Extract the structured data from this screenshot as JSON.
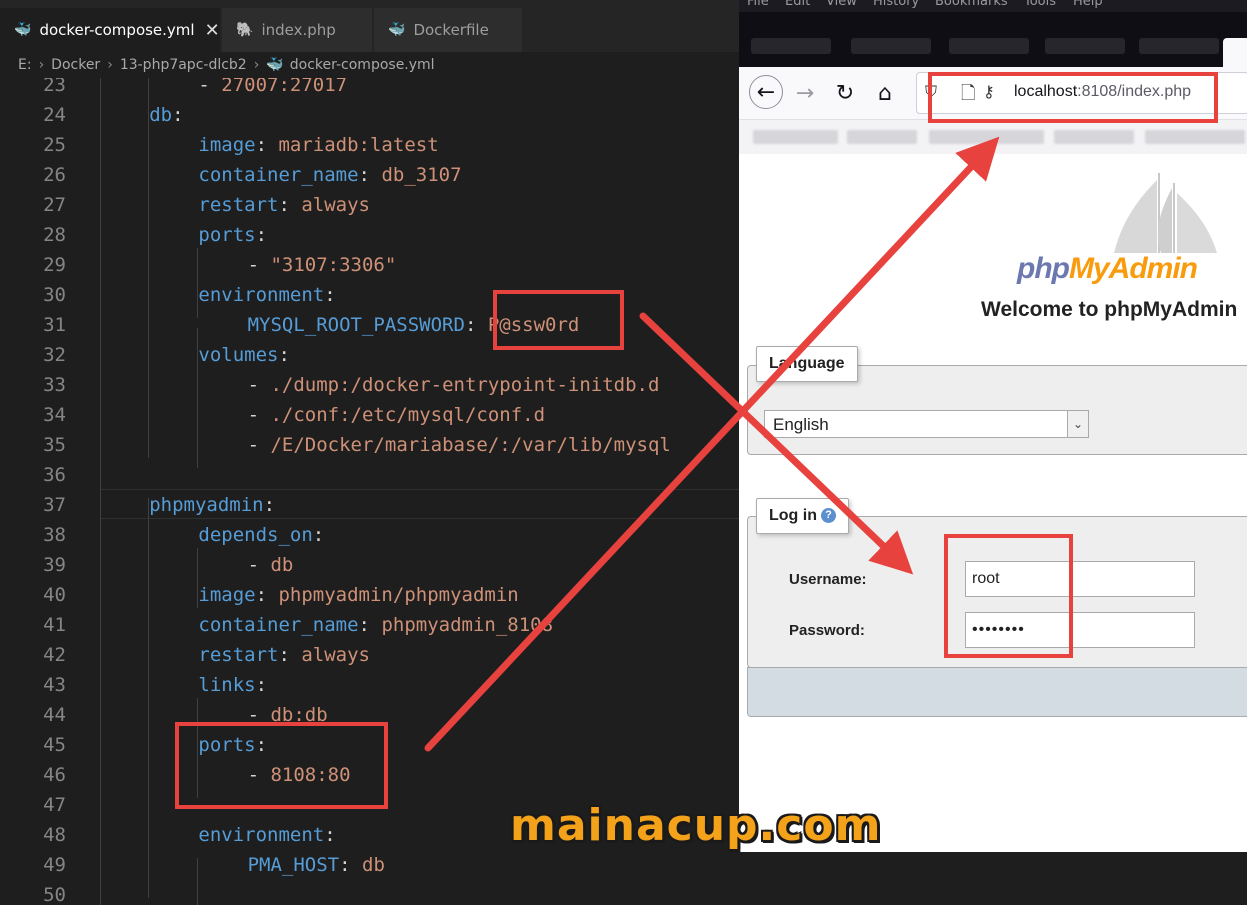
{
  "editor": {
    "tabs": [
      {
        "label": "docker-compose.yml",
        "icon": "docker-icon",
        "active": true
      },
      {
        "label": "index.php",
        "icon": "php-icon",
        "active": false
      },
      {
        "label": "Dockerfile",
        "icon": "docker-icon",
        "active": false
      }
    ],
    "breadcrumb": [
      "E:",
      "Docker",
      "13-php7apc-dlcb2",
      "docker-compose.yml"
    ],
    "lines": [
      {
        "n": "23",
        "indent": 4,
        "tokens": [
          [
            "p",
            "- "
          ],
          [
            "v",
            "27007:27017"
          ]
        ]
      },
      {
        "n": "24",
        "indent": 2,
        "tokens": [
          [
            "k",
            "db"
          ],
          [
            "p",
            ":"
          ]
        ]
      },
      {
        "n": "25",
        "indent": 4,
        "tokens": [
          [
            "k",
            "image"
          ],
          [
            "p",
            ": "
          ],
          [
            "v",
            "mariadb:latest"
          ]
        ]
      },
      {
        "n": "26",
        "indent": 4,
        "tokens": [
          [
            "k",
            "container_name"
          ],
          [
            "p",
            ": "
          ],
          [
            "v",
            "db_3107"
          ]
        ]
      },
      {
        "n": "27",
        "indent": 4,
        "tokens": [
          [
            "k",
            "restart"
          ],
          [
            "p",
            ": "
          ],
          [
            "v",
            "always"
          ]
        ]
      },
      {
        "n": "28",
        "indent": 4,
        "tokens": [
          [
            "k",
            "ports"
          ],
          [
            "p",
            ":"
          ]
        ]
      },
      {
        "n": "29",
        "indent": 6,
        "tokens": [
          [
            "p",
            "- "
          ],
          [
            "v",
            "\"3107:3306\""
          ]
        ]
      },
      {
        "n": "30",
        "indent": 4,
        "tokens": [
          [
            "k",
            "environment"
          ],
          [
            "p",
            ":"
          ]
        ]
      },
      {
        "n": "31",
        "indent": 6,
        "tokens": [
          [
            "k",
            "MYSQL_ROOT_PASSWORD"
          ],
          [
            "p",
            ": "
          ],
          [
            "v",
            "P@ssw0rd"
          ]
        ]
      },
      {
        "n": "32",
        "indent": 4,
        "tokens": [
          [
            "k",
            "volumes"
          ],
          [
            "p",
            ":"
          ]
        ]
      },
      {
        "n": "33",
        "indent": 6,
        "tokens": [
          [
            "p",
            "- "
          ],
          [
            "v",
            "./dump:/docker-entrypoint-initdb.d"
          ]
        ]
      },
      {
        "n": "34",
        "indent": 6,
        "tokens": [
          [
            "p",
            "- "
          ],
          [
            "v",
            "./conf:/etc/mysql/conf.d"
          ]
        ]
      },
      {
        "n": "35",
        "indent": 6,
        "tokens": [
          [
            "p",
            "- "
          ],
          [
            "v",
            "/E/Docker/mariabase/:/var/lib/mysql"
          ]
        ]
      },
      {
        "n": "36",
        "indent": 0,
        "tokens": []
      },
      {
        "n": "37",
        "indent": 2,
        "tokens": [
          [
            "k",
            "phpmyadmin"
          ],
          [
            "p",
            ":"
          ]
        ]
      },
      {
        "n": "38",
        "indent": 4,
        "tokens": [
          [
            "k",
            "depends_on"
          ],
          [
            "p",
            ":"
          ]
        ]
      },
      {
        "n": "39",
        "indent": 6,
        "tokens": [
          [
            "p",
            "- "
          ],
          [
            "v",
            "db"
          ]
        ]
      },
      {
        "n": "40",
        "indent": 4,
        "tokens": [
          [
            "k",
            "image"
          ],
          [
            "p",
            ": "
          ],
          [
            "v",
            "phpmyadmin/phpmyadmin"
          ]
        ]
      },
      {
        "n": "41",
        "indent": 4,
        "tokens": [
          [
            "k",
            "container_name"
          ],
          [
            "p",
            ": "
          ],
          [
            "v",
            "phpmyadmin_8108"
          ]
        ]
      },
      {
        "n": "42",
        "indent": 4,
        "tokens": [
          [
            "k",
            "restart"
          ],
          [
            "p",
            ": "
          ],
          [
            "v",
            "always"
          ]
        ]
      },
      {
        "n": "43",
        "indent": 4,
        "tokens": [
          [
            "k",
            "links"
          ],
          [
            "p",
            ":"
          ]
        ]
      },
      {
        "n": "44",
        "indent": 6,
        "tokens": [
          [
            "p",
            "- "
          ],
          [
            "v",
            "db:db"
          ]
        ]
      },
      {
        "n": "45",
        "indent": 4,
        "tokens": [
          [
            "k",
            "ports"
          ],
          [
            "p",
            ":"
          ]
        ]
      },
      {
        "n": "46",
        "indent": 6,
        "tokens": [
          [
            "p",
            "- "
          ],
          [
            "v",
            "8108:80"
          ]
        ]
      },
      {
        "n": "47",
        "indent": 0,
        "tokens": []
      },
      {
        "n": "48",
        "indent": 4,
        "tokens": [
          [
            "k",
            "environment"
          ],
          [
            "p",
            ":"
          ]
        ]
      },
      {
        "n": "49",
        "indent": 6,
        "tokens": [
          [
            "k",
            "PMA_HOST"
          ],
          [
            "p",
            ": "
          ],
          [
            "v",
            "db"
          ]
        ]
      },
      {
        "n": "50",
        "indent": 0,
        "tokens": []
      }
    ]
  },
  "browser": {
    "menu": [
      "File",
      "Edit",
      "View",
      "History",
      "Bookmarks",
      "Tools",
      "Help"
    ],
    "url": {
      "host": "localhost",
      "rest": ":8108/index.php"
    },
    "pma": {
      "logo_php": "php",
      "logo_myadmin": "MyAdmin",
      "welcome": "Welcome to phpMyAdmin",
      "language_legend": "Language",
      "language_value": "English",
      "login_legend": "Log in",
      "username_label": "Username:",
      "username_value": "root",
      "password_label": "Password:",
      "password_value": "••••••••"
    }
  },
  "watermark": "mainacup.com",
  "colors": {
    "annotation_red": "#e8423f",
    "yaml_key": "#569cd6",
    "yaml_value": "#ce9178",
    "watermark": "#f5a21b"
  }
}
